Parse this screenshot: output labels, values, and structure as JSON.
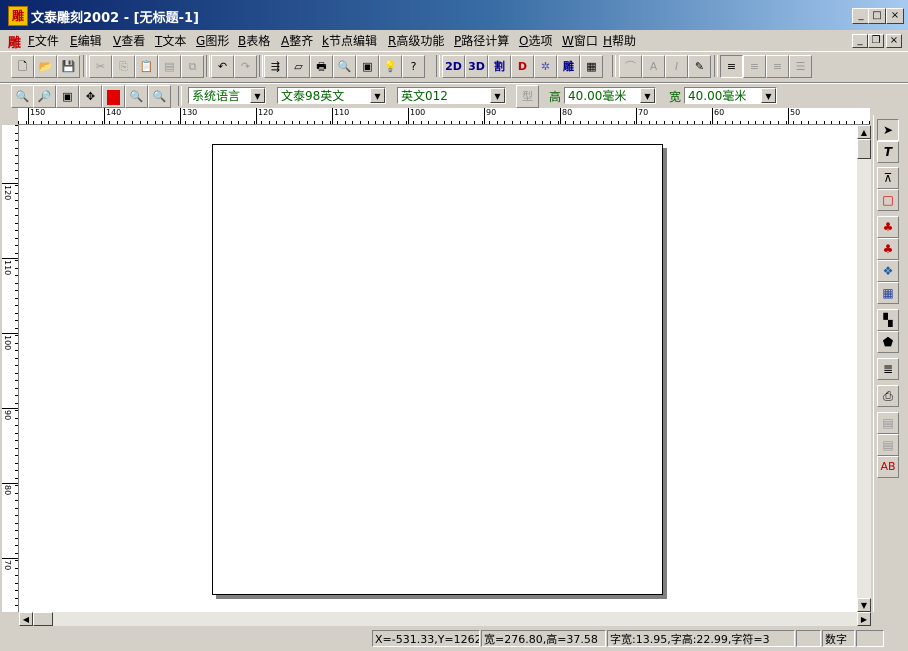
{
  "window": {
    "title": "文泰雕刻2002 - [无标题-1]",
    "logo_text": "雕",
    "min_glyph": "_",
    "max_glyph": "□",
    "close_glyph": "×",
    "restore_glyph": "❐"
  },
  "menu": [
    {
      "key": "F",
      "label": "文件"
    },
    {
      "key": "E",
      "label": "编辑"
    },
    {
      "key": "V",
      "label": "查看"
    },
    {
      "key": "T",
      "label": "文本"
    },
    {
      "key": "G",
      "label": "图形"
    },
    {
      "key": "B",
      "label": "表格"
    },
    {
      "key": "A",
      "label": "整齐"
    },
    {
      "key": "k",
      "label": "节点编辑"
    },
    {
      "key": "R",
      "label": "高级功能"
    },
    {
      "key": "P",
      "label": "路径计算"
    },
    {
      "key": "O",
      "label": "选项"
    },
    {
      "key": "W",
      "label": "窗口"
    },
    {
      "key": "H",
      "label": "帮助"
    }
  ],
  "toolbar1": {
    "btn_2d": "2D",
    "btn_3d": "3D",
    "btn_cut": "割",
    "btn_carve": "雕",
    "btn_d": "D"
  },
  "toolbar2": {
    "language": "系统语言",
    "font_name": "文泰98英文",
    "font_style": "英文012",
    "type_label": "型",
    "height_label": "高",
    "height_value": "40.00毫米",
    "width_label": "宽",
    "width_value": "40.00毫米"
  },
  "ruler": {
    "h_labels": [
      "150",
      "140",
      "130",
      "120",
      "110",
      "100",
      "90",
      "80",
      "70",
      "60",
      "50"
    ],
    "v_labels": [
      "120",
      "110",
      "100",
      "90",
      "80",
      "70"
    ]
  },
  "status": {
    "coords": "X=-531.33,Y=1262.",
    "size": "宽=276.80,高=37.58",
    "char_info": "字宽:13.95,字高:22.99,字符=3",
    "mode": "数字"
  },
  "colors": {
    "title_start": "#0a246a",
    "title_end": "#a6caf0",
    "chrome": "#d4d0c8",
    "accent_red": "#e00000",
    "label_green": "#006400"
  }
}
